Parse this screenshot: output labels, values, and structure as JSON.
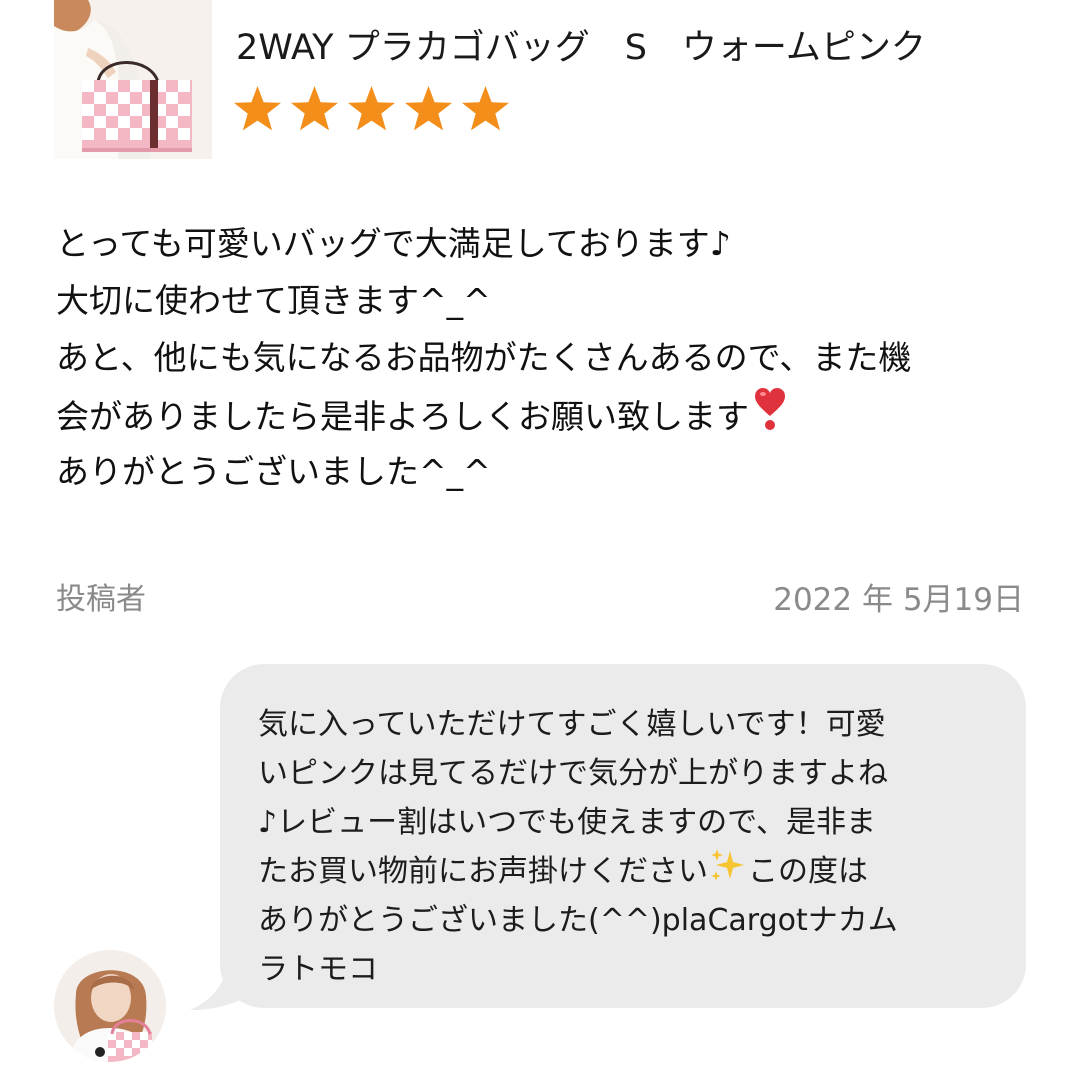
{
  "product": {
    "name": "2WAY プラカゴバッグ　S　ウォームピンク",
    "thumbnail_icon": "bag-photo",
    "rating": 5,
    "rating_max": 5,
    "star_color": "#f38e1b"
  },
  "review": {
    "lines": [
      "とっても可愛いバッグで大満足しております♪",
      "大切に使わせて頂きます^_^",
      "あと、他にも気になるお品物がたくさんあるので、また機",
      "会がありましたら是非よろしくお願い致します",
      "ありがとうございました^_^"
    ],
    "trailing_icon": "heart-exclamation-icon",
    "poster_label": "投稿者",
    "date": "2022 年 5月19日"
  },
  "reply": {
    "lines": [
      "気に入っていただけてすごく嬉しいです！可愛",
      "いピンクは見てるだけで気分が上がりますよね",
      "♪レビュー割はいつでも使えますので、是非ま",
      "たお買い物前にお声掛けください",
      "この度は",
      "ありがとうございました(^^)plaCargotナカム",
      "ラトモコ"
    ],
    "inline_icon": "sparkles-icon",
    "bubble_color": "#ebebeb",
    "avatar_icon": "seller-avatar-photo"
  }
}
